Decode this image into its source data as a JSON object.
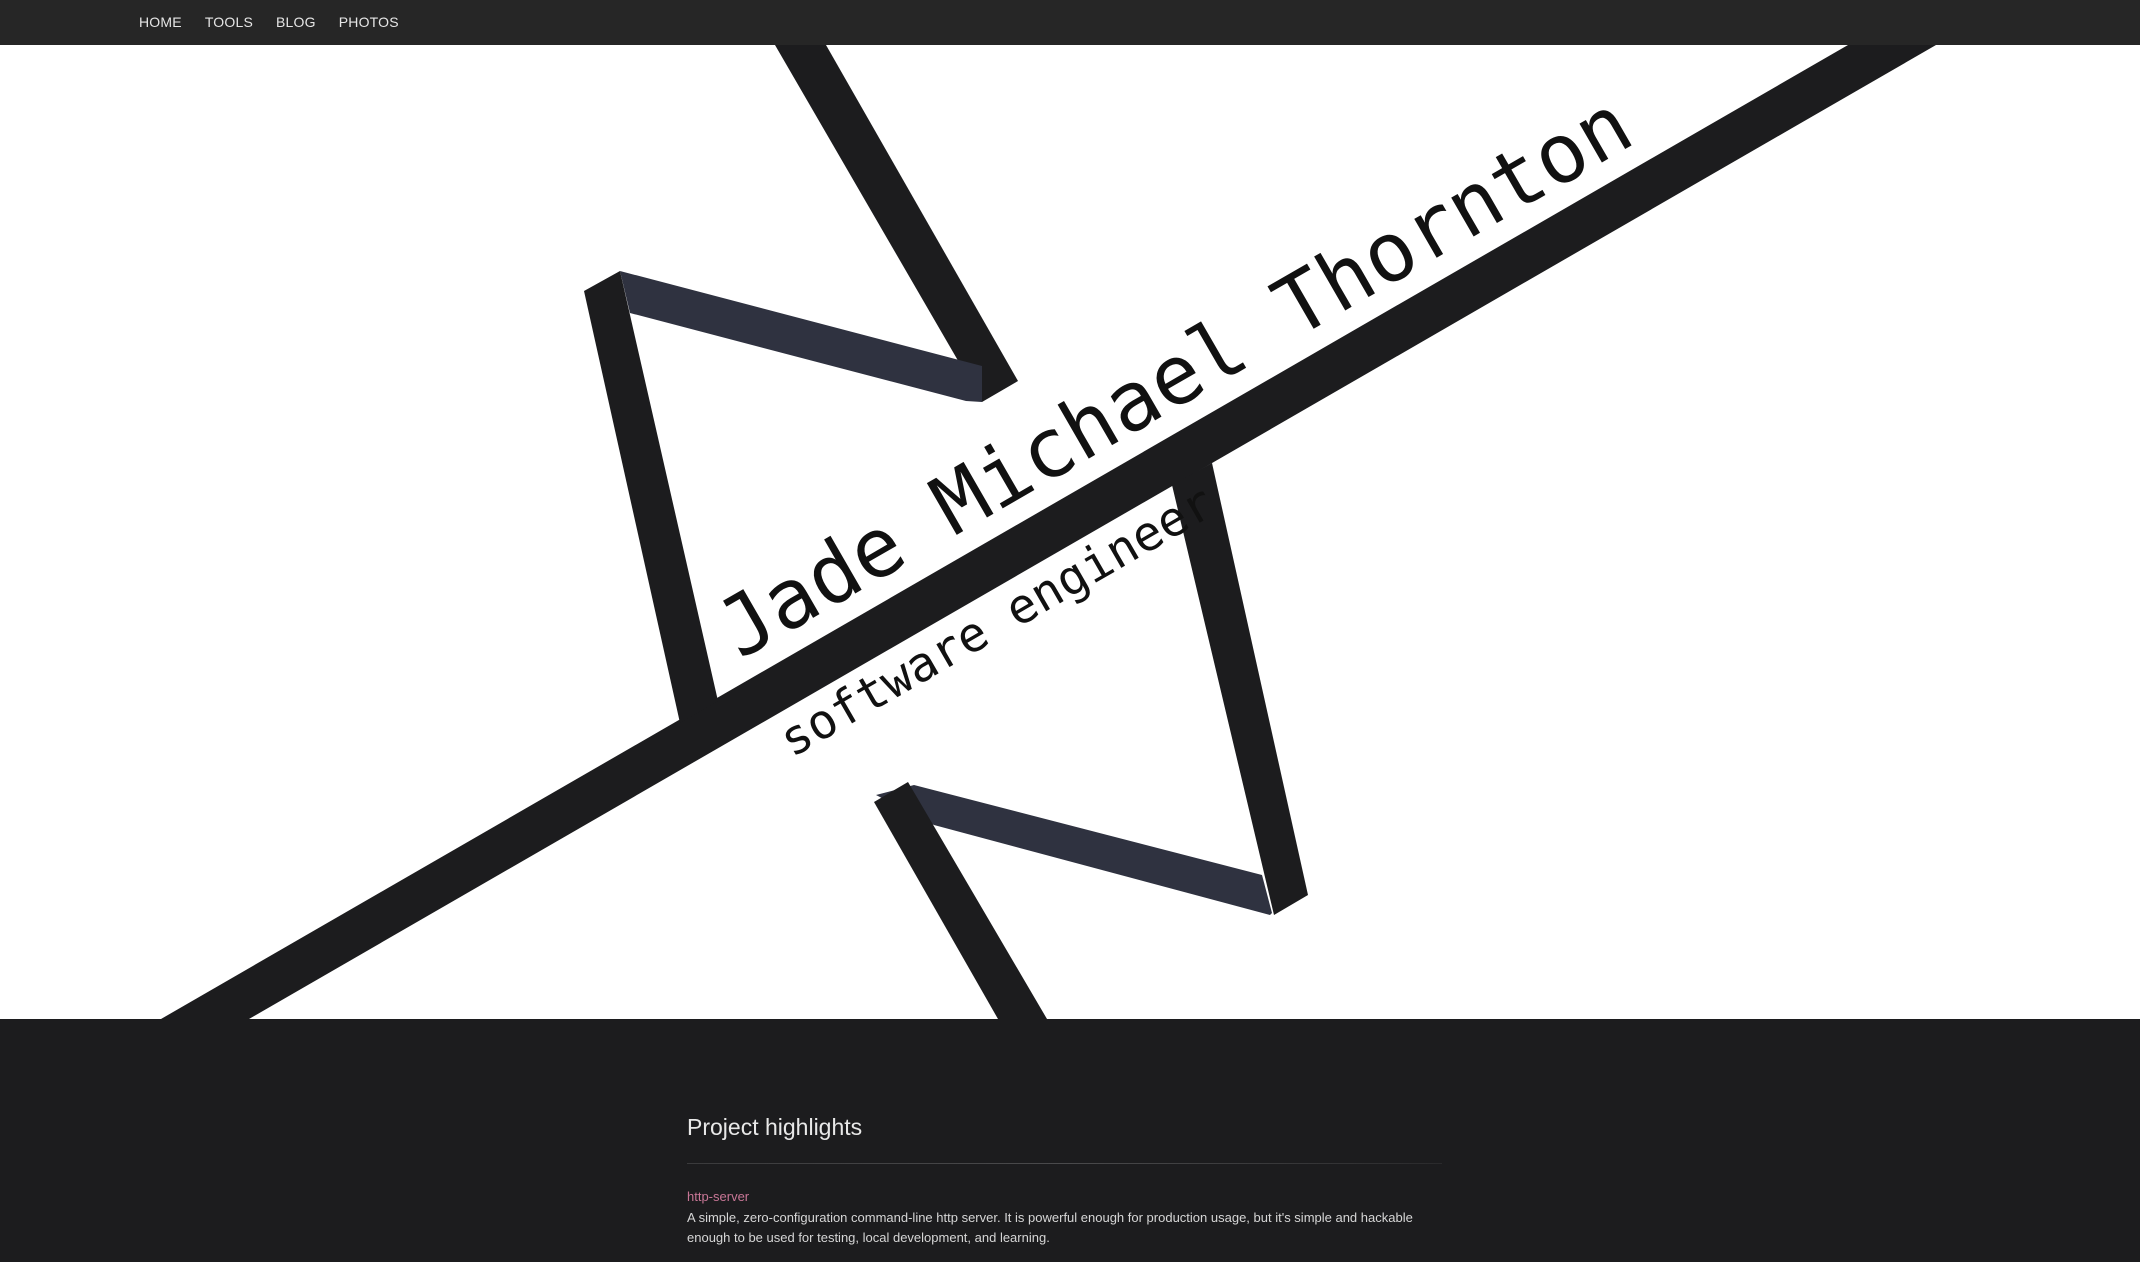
{
  "nav": {
    "items": [
      {
        "label": "HOME"
      },
      {
        "label": "TOOLS"
      },
      {
        "label": "BLOG"
      },
      {
        "label": "PHOTOS"
      }
    ]
  },
  "hero": {
    "name": "Jade Michael Thornton",
    "subtitle": "software engineer",
    "logo_color": "#1c1c1e",
    "logo_accent_color": "#2f3240"
  },
  "projects": {
    "heading": "Project highlights",
    "items": [
      {
        "name": "http-server",
        "description": "A simple, zero-configuration command-line http server. It is powerful enough for production usage, but it's simple and hackable enough to be used for testing, local development, and learning."
      }
    ]
  },
  "colors": {
    "nav_background": "#262626",
    "page_background": "#1c1c1e",
    "hero_background": "#ffffff",
    "link_accent": "#c87696"
  }
}
